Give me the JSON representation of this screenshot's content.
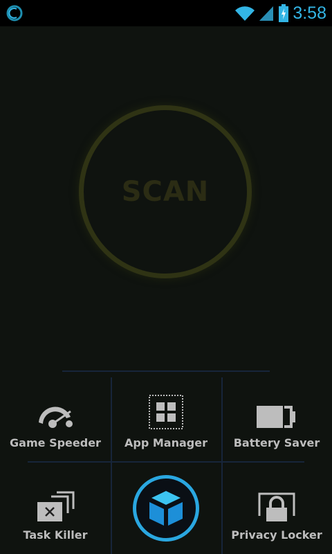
{
  "status_bar": {
    "time": "3:58",
    "app_icon": "cleaner-notification-icon",
    "wifi": "wifi-icon",
    "signal": "signal-icon",
    "battery": "battery-charging-icon"
  },
  "scan": {
    "label": "SCAN"
  },
  "tools": [
    {
      "label": "Game Speeder",
      "icon": "speedometer-icon"
    },
    {
      "label": "App Manager",
      "icon": "app-grid-icon"
    },
    {
      "label": "Battery Saver",
      "icon": "battery-icon"
    },
    {
      "label": "Task Killer",
      "icon": "task-close-icon"
    },
    {
      "label": "Privacy Locker",
      "icon": "lock-icon"
    }
  ],
  "center_button": {
    "icon": "cube-icon"
  },
  "colors": {
    "accent": "#33b5e5",
    "ring": "#2f3314",
    "label": "#bdbdbd"
  }
}
